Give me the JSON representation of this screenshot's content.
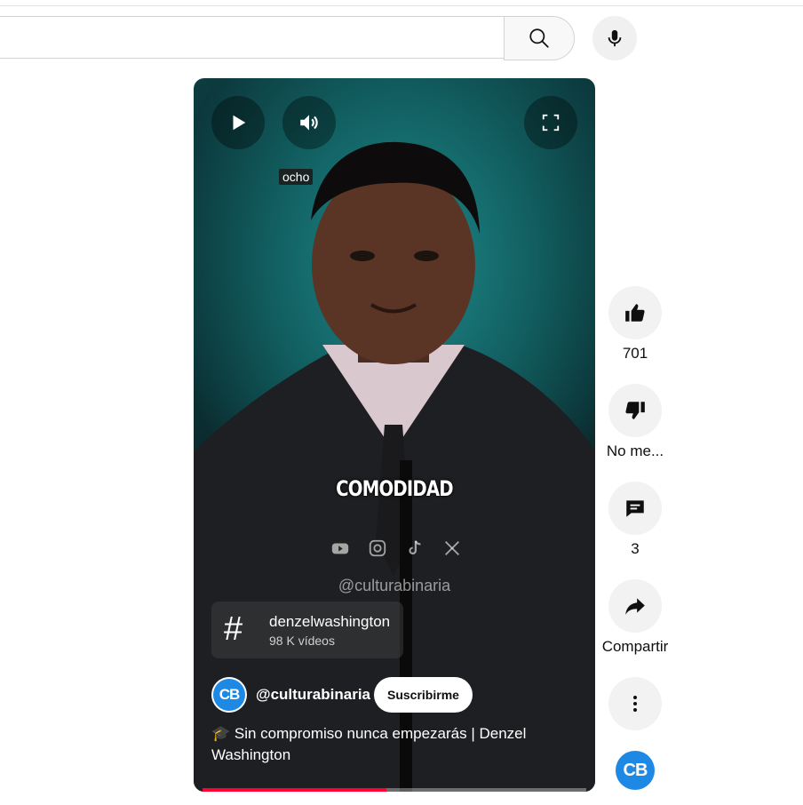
{
  "search": {
    "placeholder": ""
  },
  "player": {
    "tooltip": "ocho",
    "caption": "COMODIDAD",
    "watermark": "@culturabinaria",
    "hashtag": {
      "title": "denzelwashington",
      "subtitle": "98 K vídeos"
    },
    "channel": {
      "avatar_text": "CB",
      "handle": "@culturabinaria",
      "subscribe_label": "Suscribirme"
    },
    "title": "🎓 Sin compromiso nunca empezarás | Denzel Washington",
    "progress_percent": 48
  },
  "actions": {
    "like_count": "701",
    "dislike_label": "No me...",
    "comments_count": "3",
    "share_label": "Compartir"
  },
  "side_avatar_text": "CB",
  "colors": {
    "accent": "#ff0033",
    "channel_avatar": "#1e88e5"
  }
}
